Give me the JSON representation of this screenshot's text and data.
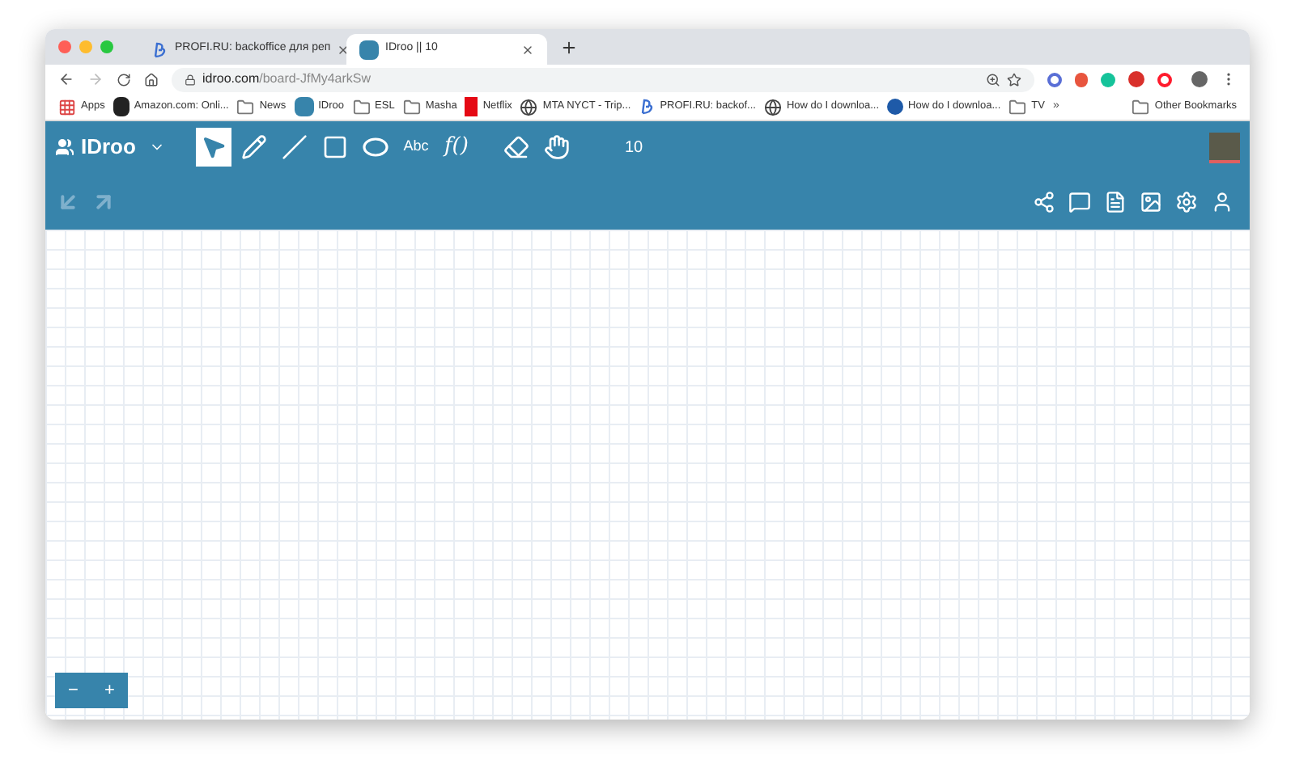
{
  "browser": {
    "tabs": [
      {
        "title": "PROFI.RU: backoffice для реп",
        "selected": false,
        "kind": "profi"
      },
      {
        "title": "IDroo || 10",
        "selected": true,
        "kind": "idroo"
      }
    ],
    "address": {
      "host": "idroo.com",
      "path": "/board-JfMy4arkSw"
    },
    "bookmarks": [
      {
        "label": "Apps",
        "kind": "apps"
      },
      {
        "label": "Amazon.com: Onli...",
        "kind": "amazon"
      },
      {
        "label": "News",
        "kind": "folder"
      },
      {
        "label": "IDroo",
        "kind": "idroo"
      },
      {
        "label": "ESL",
        "kind": "folder"
      },
      {
        "label": "Masha",
        "kind": "folder"
      },
      {
        "label": "Netflix",
        "kind": "netflix"
      },
      {
        "label": "MTA NYCT - Trip...",
        "kind": "globe"
      },
      {
        "label": "PROFI.RU: backof...",
        "kind": "profi"
      },
      {
        "label": "How do I downloa...",
        "kind": "globe"
      },
      {
        "label": "How do I downloa...",
        "kind": "circle"
      },
      {
        "label": "TV",
        "kind": "folder"
      }
    ],
    "more": "»",
    "other": "Other Bookmarks"
  },
  "app": {
    "brand": "IDroo",
    "tools": [
      {
        "kind": "select",
        "selected": true
      },
      {
        "kind": "pencil",
        "selected": false
      },
      {
        "kind": "line",
        "selected": false
      },
      {
        "kind": "rect",
        "selected": false
      },
      {
        "kind": "ellipse",
        "selected": false
      },
      {
        "kind": "text",
        "label": "Abc",
        "selected": false
      },
      {
        "kind": "formula",
        "label": "f()",
        "selected": false
      },
      {
        "kind": "eraser",
        "selected": false
      },
      {
        "kind": "hand",
        "selected": false
      }
    ],
    "page": "10",
    "zoom": {
      "minus": "−",
      "plus": "+"
    }
  }
}
